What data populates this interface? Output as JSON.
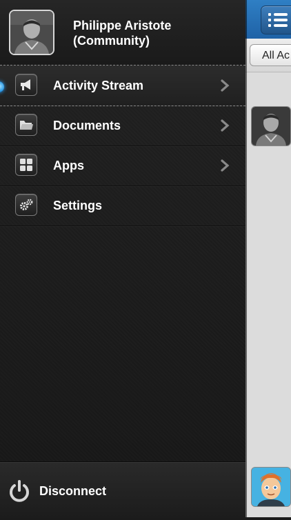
{
  "profile": {
    "name": "Philippe Aristote\n(Community)"
  },
  "menu": {
    "items": [
      {
        "label": "Activity Stream",
        "icon": "megaphone-icon",
        "active": true,
        "has_chevron": true
      },
      {
        "label": "Documents",
        "icon": "folder-icon",
        "active": false,
        "has_chevron": true
      },
      {
        "label": "Apps",
        "icon": "apps-grid-icon",
        "active": false,
        "has_chevron": true
      },
      {
        "label": "Settings",
        "icon": "gears-icon",
        "active": false,
        "has_chevron": false
      }
    ],
    "footer_label": "Disconnect"
  },
  "content": {
    "filter_label": "All Ac"
  },
  "colors": {
    "accent_blue": "#1f62a6",
    "menu_bg": "#1b1b1b",
    "active_dot": "#1d8fe0"
  }
}
